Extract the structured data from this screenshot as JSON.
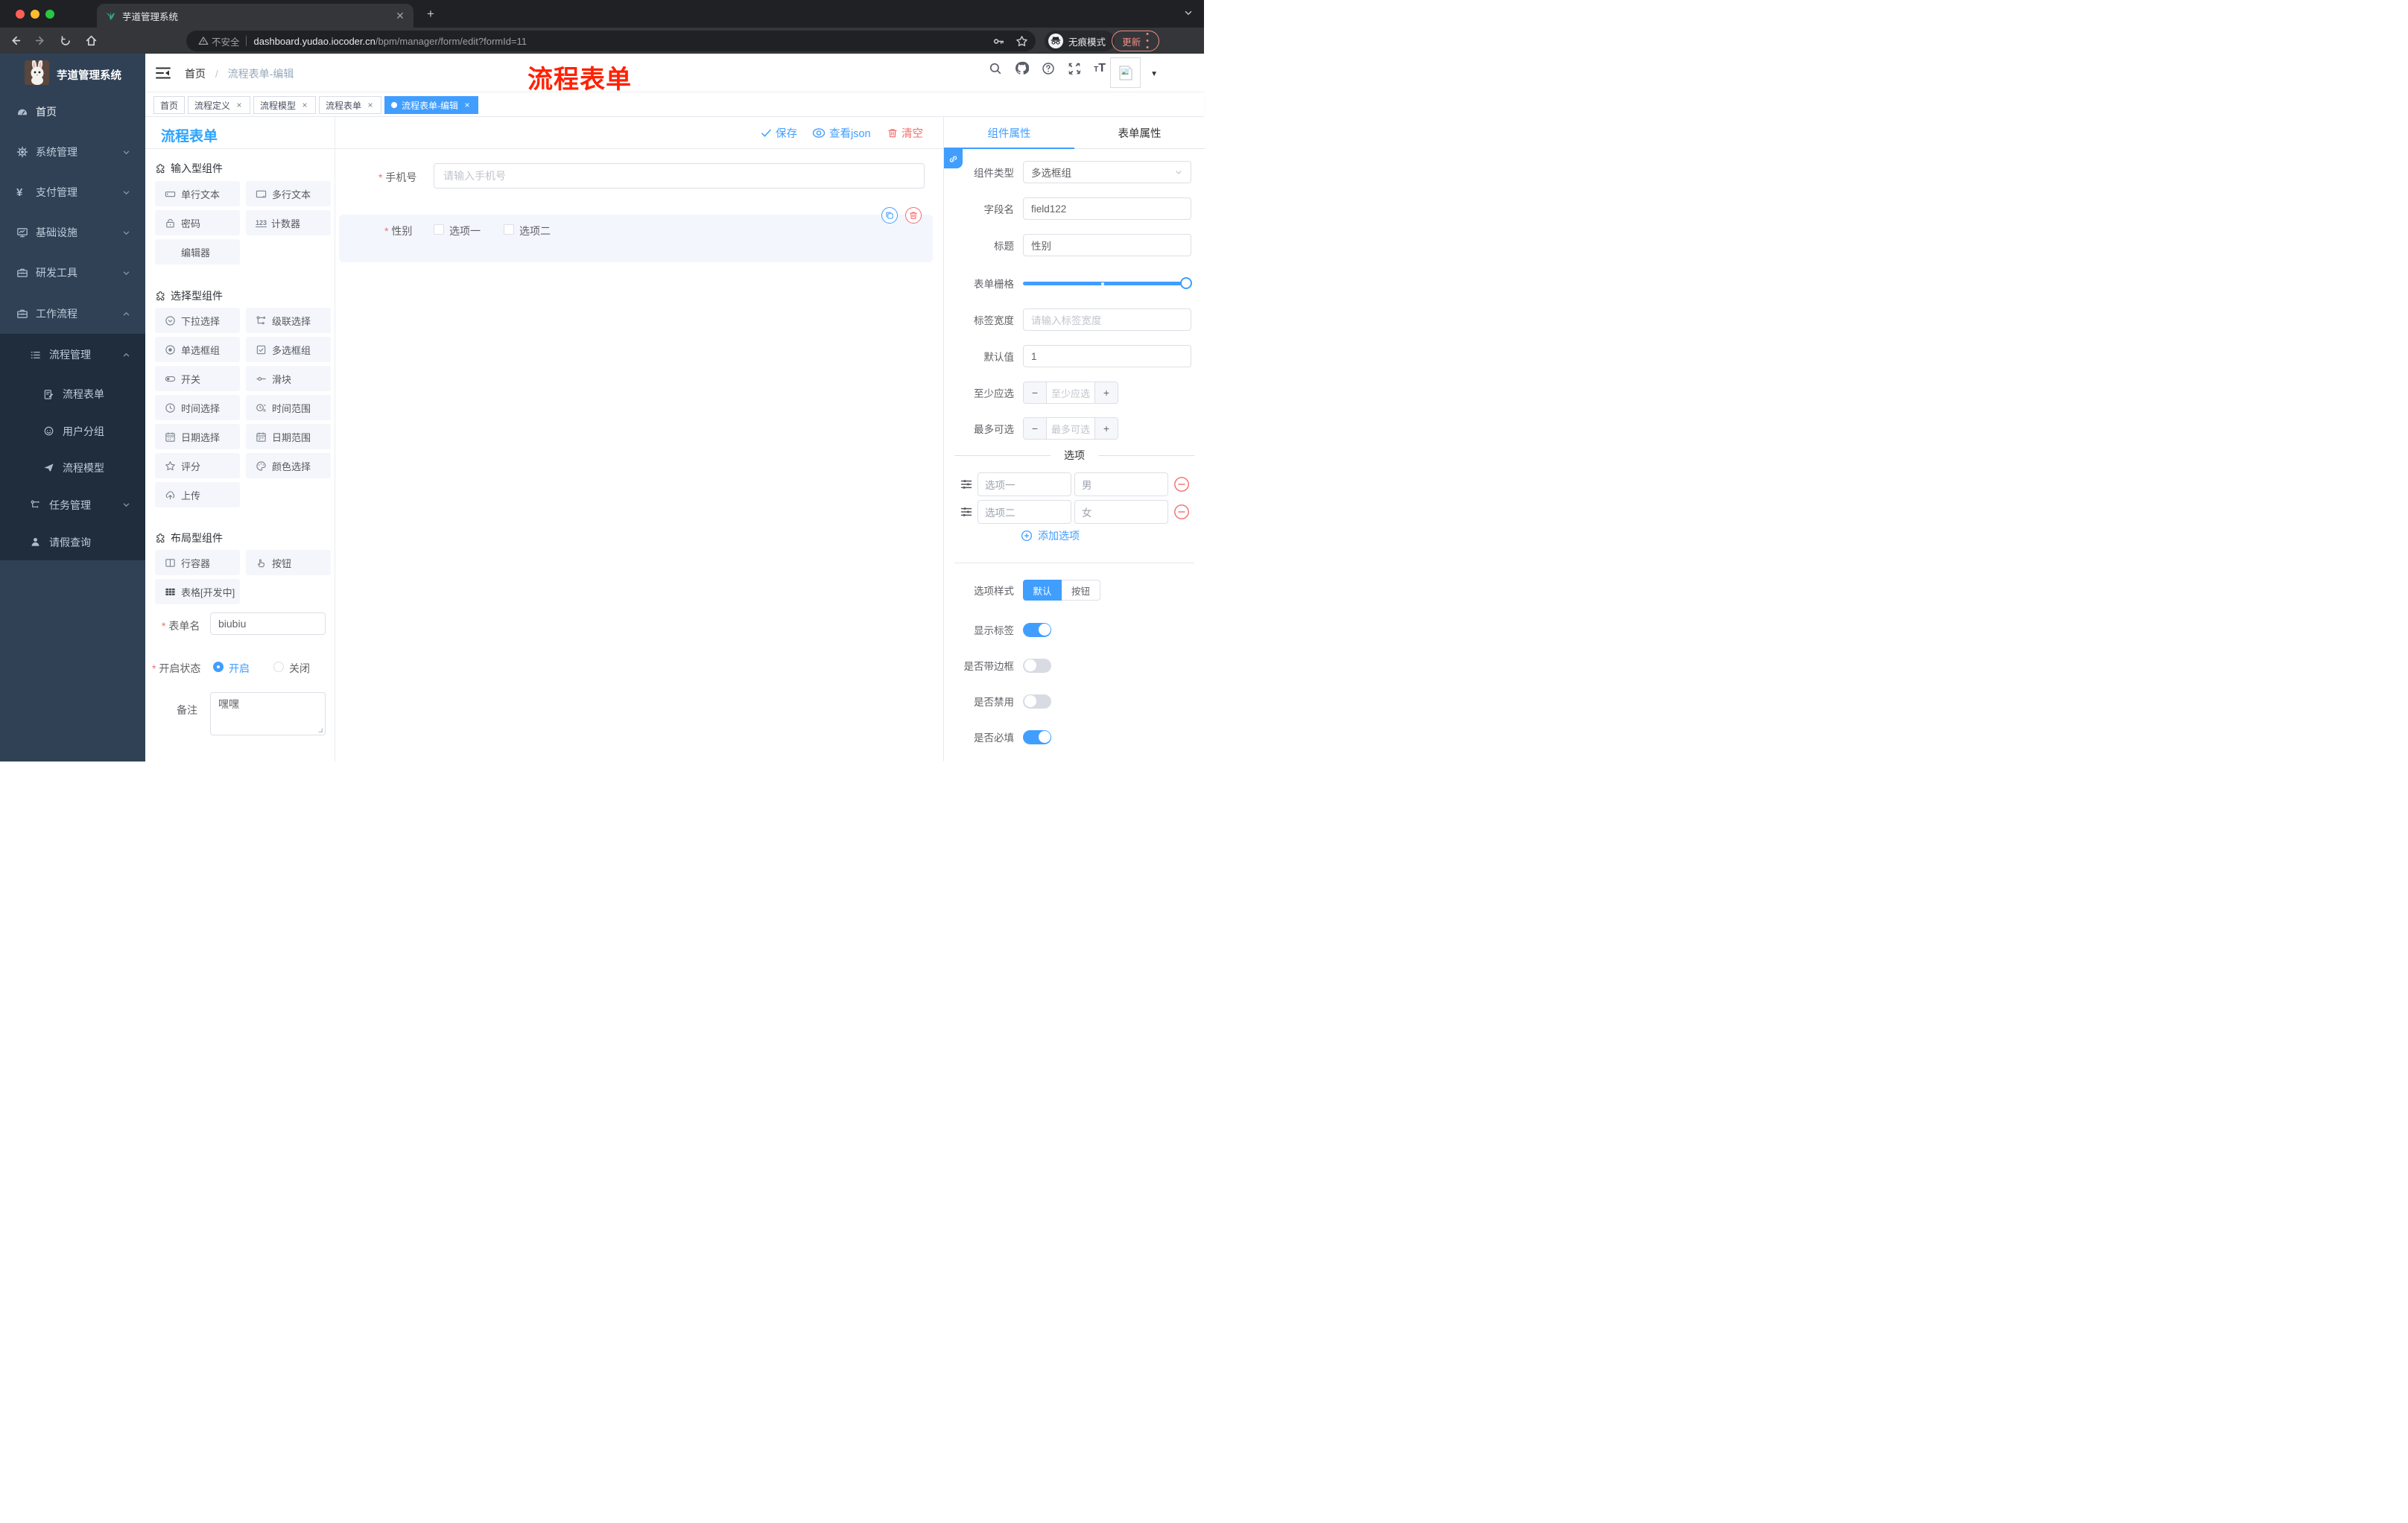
{
  "browser": {
    "tab_title": "芋道管理系统",
    "security": "不安全",
    "url_domain": "dashboard.yudao.iocoder.cn",
    "url_path": "/bpm/manager/form/edit?formId=11",
    "incognito": "无痕模式",
    "update": "更新"
  },
  "sidebar": {
    "logo_title": "芋道管理系统",
    "items": [
      {
        "label": "首页"
      },
      {
        "label": "系统管理"
      },
      {
        "label": "支付管理"
      },
      {
        "label": "基础设施"
      },
      {
        "label": "研发工具"
      },
      {
        "label": "工作流程"
      }
    ],
    "submenu": {
      "group": "流程管理",
      "children": [
        {
          "label": "流程表单"
        },
        {
          "label": "用户分组"
        },
        {
          "label": "流程模型"
        }
      ],
      "tasks": "任务管理",
      "leave": "请假查询"
    }
  },
  "header": {
    "breadcrumb_home": "首页",
    "breadcrumb_sep": "/",
    "breadcrumb_current": "流程表单-编辑",
    "watermark": "流程表单"
  },
  "tags": {
    "t0": "首页",
    "t1": "流程定义",
    "t2": "流程模型",
    "t3": "流程表单",
    "t4": "流程表单-编辑"
  },
  "palette": {
    "title": "流程表单",
    "sections": [
      {
        "title": "输入型组件",
        "items": [
          {
            "label": "单行文本"
          },
          {
            "label": "多行文本"
          },
          {
            "label": "密码"
          },
          {
            "label": "计数器"
          },
          {
            "label": "编辑器"
          }
        ]
      },
      {
        "title": "选择型组件",
        "items": [
          {
            "label": "下拉选择"
          },
          {
            "label": "级联选择"
          },
          {
            "label": "单选框组"
          },
          {
            "label": "多选框组"
          },
          {
            "label": "开关"
          },
          {
            "label": "滑块"
          },
          {
            "label": "时间选择"
          },
          {
            "label": "时间范围"
          },
          {
            "label": "日期选择"
          },
          {
            "label": "日期范围"
          },
          {
            "label": "评分"
          },
          {
            "label": "颜色选择"
          },
          {
            "label": "上传"
          }
        ]
      },
      {
        "title": "布局型组件",
        "items": [
          {
            "label": "行容器"
          },
          {
            "label": "按钮"
          },
          {
            "label": "表格[开发中]"
          }
        ]
      }
    ],
    "counter_badge": "123"
  },
  "meta_form": {
    "name_label": "表单名",
    "name_value": "biubiu",
    "status_label": "开启状态",
    "status_on": "开启",
    "status_off": "关闭",
    "remark_label": "备注",
    "remark_value": "嘿嘿"
  },
  "canvas": {
    "save": "保存",
    "view_json": "查看json",
    "clear": "清空",
    "phone_label": "手机号",
    "phone_placeholder": "请输入手机号",
    "gender_label": "性别",
    "gender_opt1": "选项一",
    "gender_opt2": "选项二"
  },
  "props": {
    "tab_component": "组件属性",
    "tab_form": "表单属性",
    "type_label": "组件类型",
    "type_value": "多选框组",
    "field_label": "字段名",
    "field_value": "field122",
    "title_label": "标题",
    "title_value": "性别",
    "grid_label": "表单栅格",
    "labelwidth_label": "标签宽度",
    "labelwidth_placeholder": "请输入标签宽度",
    "default_label": "默认值",
    "default_value": "1",
    "min_label": "至少应选",
    "min_placeholder": "至少应选",
    "max_label": "最多可选",
    "max_placeholder": "最多可选",
    "minus": "−",
    "plus": "+",
    "options_title": "选项",
    "options": [
      {
        "label": "选项一",
        "value": "男"
      },
      {
        "label": "选项二",
        "value": "女"
      }
    ],
    "add_option": "添加选项",
    "style_label": "选项样式",
    "style_default": "默认",
    "style_button": "按钮",
    "show_label": "显示标签",
    "border_label": "是否带边框",
    "disabled_label": "是否禁用",
    "required_label": "是否必填"
  },
  "colors": {
    "primary": "#409eff",
    "danger": "#f56c6c",
    "watermark_red": "#ff2103",
    "sidebar_bg": "#304156",
    "submenu_bg": "#1f2d3d"
  }
}
